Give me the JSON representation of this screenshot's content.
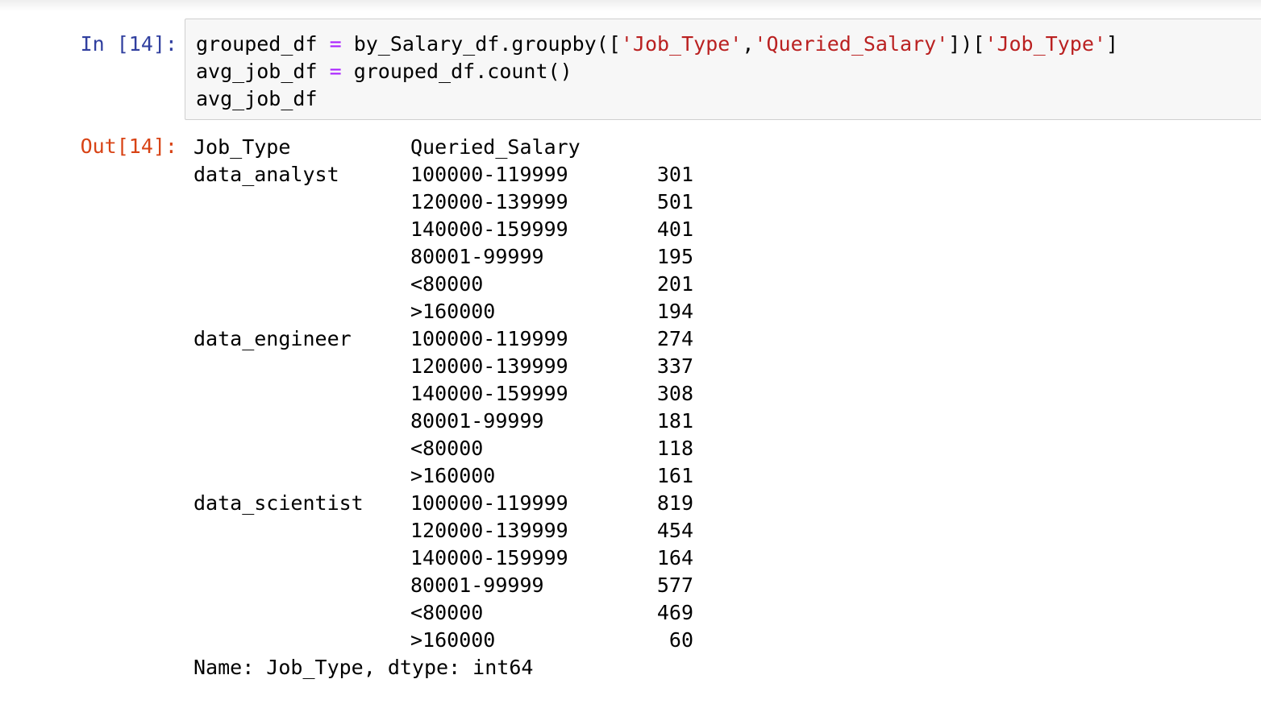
{
  "input_prompt": "In [14]:",
  "output_prompt": "Out[14]:",
  "code": {
    "line1": {
      "var": "grouped_df",
      "op": "=",
      "call_start": "by_Salary_df.groupby([",
      "str1": "'Job_Type'",
      "comma": ",",
      "str2": "'Queried_Salary'",
      "mid": "])[",
      "str3": "'Job_Type'",
      "end": "]"
    },
    "line2": {
      "var": "avg_job_df",
      "op": "=",
      "rest": "grouped_df.count()"
    },
    "line3": {
      "text": "avg_job_df"
    }
  },
  "output": {
    "header": {
      "col1": "Job_Type",
      "col2": "Queried_Salary"
    },
    "rows": [
      {
        "job": "data_analyst",
        "salary": "100000-119999",
        "count": "301"
      },
      {
        "job": "",
        "salary": "120000-139999",
        "count": "501"
      },
      {
        "job": "",
        "salary": "140000-159999",
        "count": "401"
      },
      {
        "job": "",
        "salary": "80001-99999",
        "count": "195"
      },
      {
        "job": "",
        "salary": "<80000",
        "count": "201"
      },
      {
        "job": "",
        "salary": ">160000",
        "count": "194"
      },
      {
        "job": "data_engineer",
        "salary": "100000-119999",
        "count": "274"
      },
      {
        "job": "",
        "salary": "120000-139999",
        "count": "337"
      },
      {
        "job": "",
        "salary": "140000-159999",
        "count": "308"
      },
      {
        "job": "",
        "salary": "80001-99999",
        "count": "181"
      },
      {
        "job": "",
        "salary": "<80000",
        "count": "118"
      },
      {
        "job": "",
        "salary": ">160000",
        "count": "161"
      },
      {
        "job": "data_scientist",
        "salary": "100000-119999",
        "count": "819"
      },
      {
        "job": "",
        "salary": "120000-139999",
        "count": "454"
      },
      {
        "job": "",
        "salary": "140000-159999",
        "count": "164"
      },
      {
        "job": "",
        "salary": "80001-99999",
        "count": "577"
      },
      {
        "job": "",
        "salary": "<80000",
        "count": "469"
      },
      {
        "job": "",
        "salary": ">160000",
        "count": "60"
      }
    ],
    "footer": "Name: Job_Type, dtype: int64"
  },
  "colors": {
    "in_prompt": "#303f9f",
    "out_prompt": "#d84315",
    "operator": "#aa22ff",
    "string": "#ba2121",
    "cell_background": "#f7f7f7",
    "cell_border": "#cfcfcf"
  }
}
